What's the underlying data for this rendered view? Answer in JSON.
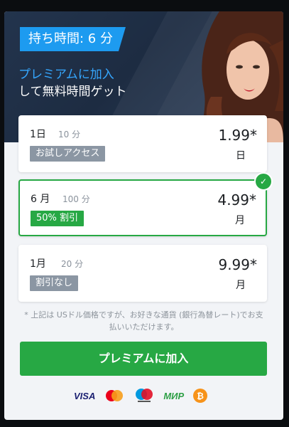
{
  "header": {
    "badge": "持ち時間: 6 分",
    "headline_highlight": "プレミアムに加入",
    "headline_rest": "して無料時間ゲット"
  },
  "plans": [
    {
      "period": "1日",
      "minutes": "10 分",
      "tag": "お試しアクセス",
      "price": "1.99*",
      "per": "日",
      "selected": false,
      "tag_color": "#8b96a3"
    },
    {
      "period": "6 月",
      "minutes": "100 分",
      "tag": "50% 割引",
      "price": "4.99*",
      "per": "月",
      "selected": true,
      "tag_color": "#27a844"
    },
    {
      "period": "1月",
      "minutes": "20 分",
      "tag": "割引なし",
      "price": "9.99*",
      "per": "月",
      "selected": false,
      "tag_color": "#8b96a3"
    }
  ],
  "note": "* 上記は USドル価格ですが、お好きな通貨 (銀行為替レート)でお支払いいただけます。",
  "cta": {
    "label": "プレミアムに加入"
  },
  "payments": [
    {
      "name": "Visa",
      "icon": "visa-logo"
    },
    {
      "name": "Mastercard",
      "icon": "mastercard-logo"
    },
    {
      "name": "Maestro",
      "icon": "maestro-logo"
    },
    {
      "name": "МИР",
      "icon": "mir-logo"
    },
    {
      "name": "Bitcoin",
      "icon": "bitcoin-logo"
    }
  ],
  "colors": {
    "accent_blue": "#1d9bf0",
    "accent_green": "#27a844",
    "hero_bg": "#23344d"
  }
}
